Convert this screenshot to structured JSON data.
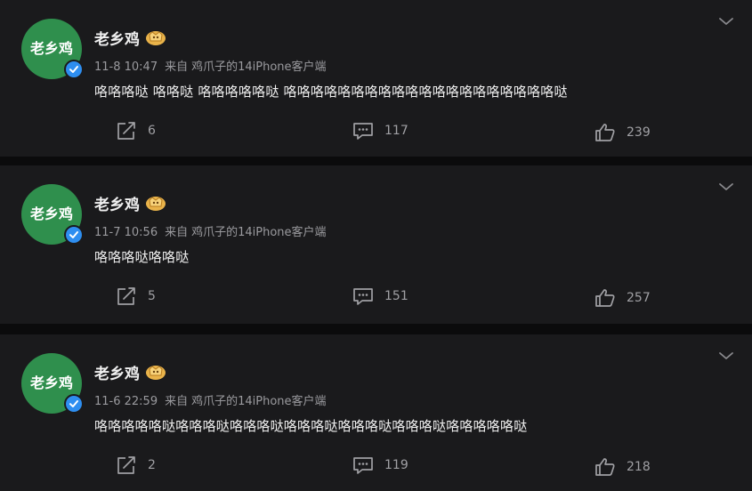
{
  "posts": [
    {
      "avatar_text": "老乡鸡",
      "username": "老乡鸡",
      "time": "11-8 10:47",
      "source_prefix": "来自",
      "source": "鸡爪子的14iPhone客户端",
      "content": "咯咯咯哒 咯咯哒 咯咯咯咯咯哒 咯咯咯咯咯咯咯咯咯咯咯咯咯咯咯咯咯咯咯咯哒",
      "reposts": "6",
      "comments": "117",
      "likes": "239"
    },
    {
      "avatar_text": "老乡鸡",
      "username": "老乡鸡",
      "time": "11-7 10:56",
      "source_prefix": "来自",
      "source": "鸡爪子的14iPhone客户端",
      "content": "咯咯咯哒咯咯哒",
      "reposts": "5",
      "comments": "151",
      "likes": "257"
    },
    {
      "avatar_text": "老乡鸡",
      "username": "老乡鸡",
      "time": "11-6 22:59",
      "source_prefix": "来自",
      "source": "鸡爪子的14iPhone客户端",
      "content": "咯咯咯咯咯哒咯咯咯哒咯咯咯哒咯咯咯哒咯咯咯哒咯咯咯哒咯咯咯咯咯哒",
      "reposts": "2",
      "comments": "119",
      "likes": "218"
    }
  ],
  "icons": {
    "verified": "verified-badge-icon",
    "crown": "crown-badge-icon",
    "more": "chevron-down-icon",
    "repost": "repost-icon",
    "comment": "comment-icon",
    "like": "thumbs-up-icon"
  },
  "colors": {
    "page_background": "#0b0b0c",
    "card_background": "#1a1a1c",
    "avatar_green": "#2f8f4d",
    "verified_blue": "#2e8ef0",
    "crown_gold": "#e9b34a",
    "meta_gray": "#9a9a9e"
  }
}
